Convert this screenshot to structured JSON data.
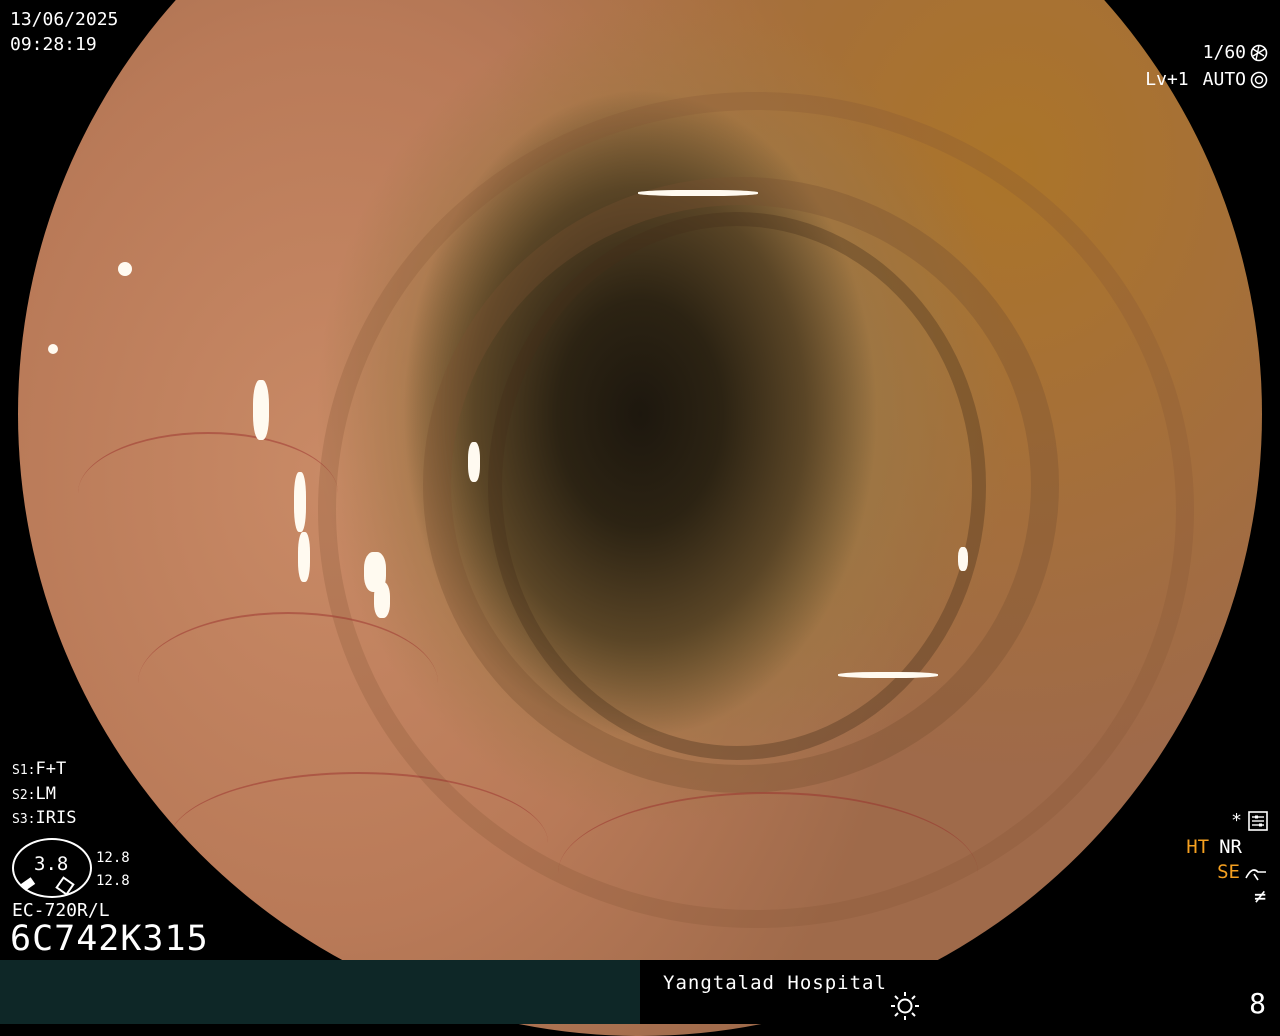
{
  "timestamp": {
    "date": "13/06/2025",
    "time": "09:28:19"
  },
  "camera": {
    "shutter": "1/60",
    "level": "Lv+1",
    "mode": "AUTO"
  },
  "settings": [
    {
      "key": "S1",
      "value": "F+T"
    },
    {
      "key": "S2",
      "value": "LM"
    },
    {
      "key": "S3",
      "value": "IRIS"
    }
  ],
  "zoom": {
    "value": "3.8",
    "r1": "12.8",
    "r2": "12.8"
  },
  "scope": {
    "model": "EC-720R/L",
    "serial": "6C742K315"
  },
  "enhancement": {
    "star": "*",
    "ht": "HT",
    "nr": "NR",
    "se": "SE",
    "fx": "≠"
  },
  "footer": {
    "hospital": "Yangtalad Hospital",
    "page": "8"
  },
  "icons": {
    "shutter": "shutter-icon",
    "auto": "iris-icon",
    "settings": "settings-icon",
    "se": "se-curve-icon",
    "sun": "brightness-icon"
  },
  "colors": {
    "highlight": "#f5a020",
    "footer_panel": "#0e2727"
  }
}
